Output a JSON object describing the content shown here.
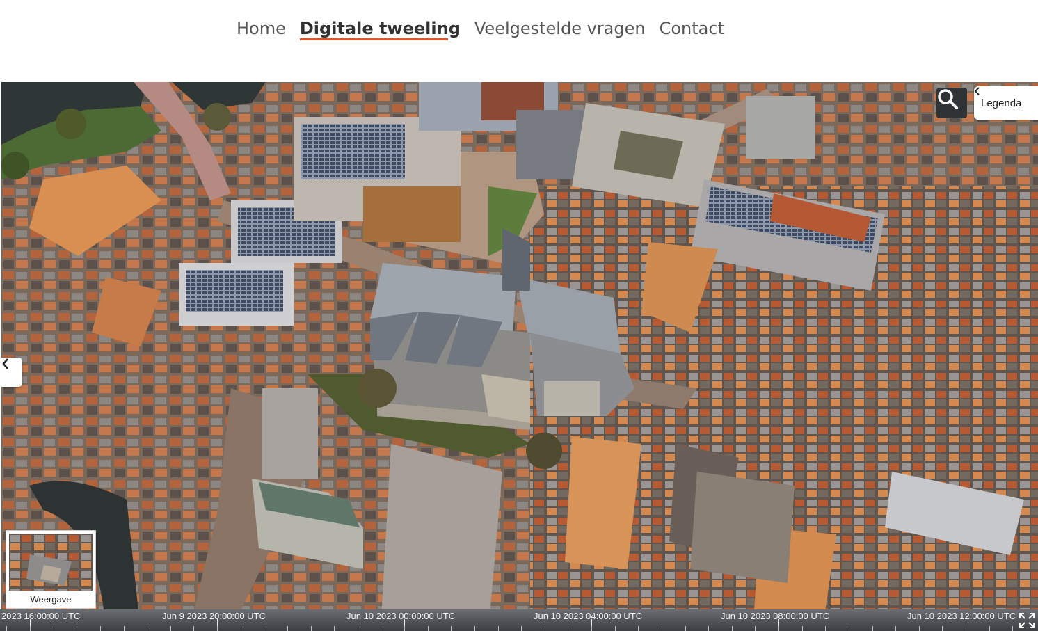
{
  "nav": {
    "items": [
      {
        "label": "Home",
        "active": false
      },
      {
        "label": "Digitale tweeling",
        "active": true
      },
      {
        "label": "Veelgestelde vragen",
        "active": false
      },
      {
        "label": "Contact",
        "active": false
      }
    ]
  },
  "map": {
    "view": "3D aerial city model",
    "search_icon": "search-icon",
    "legend_label": "Legenda",
    "legend_icon": "chevron-left-icon",
    "side_panel_icon": "chevron-left-icon",
    "basemap_label": "Weergave",
    "fullscreen_icon": "fullscreen-icon"
  },
  "timeline": {
    "labels": [
      "2023 16:00:00 UTC",
      "Jun 9 2023 20:00:00 UTC",
      "Jun 10 2023 00:00:00 UTC",
      "Jun 10 2023 04:00:00 UTC",
      "Jun 10 2023 08:00:00 UTC",
      "Jun 10 2023 12:00:00 UTC"
    ]
  },
  "colors": {
    "accent_underline": "#e8542a",
    "toolbar_dark": "#303336"
  }
}
